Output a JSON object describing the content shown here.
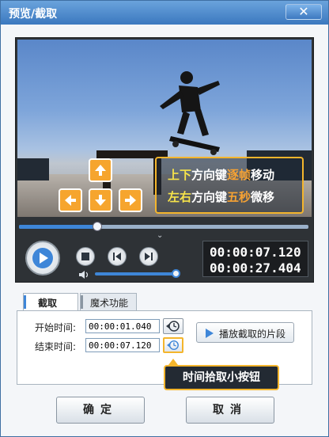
{
  "window": {
    "title": "预览/截取",
    "close_glyph": "✕"
  },
  "video": {
    "hint_line1": {
      "part1": "上下",
      "part2": "方向键",
      "part3": "逐帧",
      "part4": "移动"
    },
    "hint_line2": {
      "part1": "左右",
      "part2": "方向键",
      "part3": "五秒",
      "part4": "微移"
    },
    "seek_progress": 0.27,
    "volume_level": 0.95
  },
  "player": {
    "current_time": "00:00:07.120",
    "total_time": "00:00:27.404",
    "icons": [
      "play-icon",
      "stop-icon",
      "prev-frame-icon",
      "next-frame-icon",
      "volume-icon"
    ]
  },
  "tabs": [
    {
      "label": "截取",
      "active": true
    },
    {
      "label": "魔术功能",
      "active": false
    }
  ],
  "clip": {
    "start_label": "开始时间:",
    "start_value": "00:00:01.040",
    "end_label": "结束时间:",
    "end_value": "00:00:07.120",
    "play_clip_label": "播放截取的片段"
  },
  "callout": "时间拾取小按钮",
  "buttons": {
    "ok": "确定",
    "cancel": "取消"
  },
  "colors": {
    "accent": "#3e86d8",
    "highlight": "#f4b52c",
    "hint_yellow": "#f6e34a",
    "hint_orange": "#f6a233"
  }
}
